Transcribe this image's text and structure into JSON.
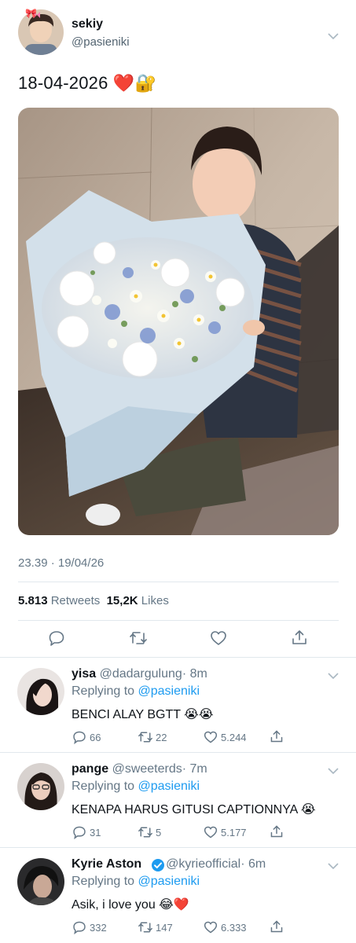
{
  "tweet": {
    "author_name": "sekiy",
    "author_handle": "@pasieniki",
    "author_emoji": "🎀",
    "text": "18-04-2026 ❤️🔐",
    "timestamp": "23.39 · 19/04/26",
    "retweets_count": "5.813",
    "retweets_label": "Retweets",
    "likes_count": "15,2K",
    "likes_label": "Likes"
  },
  "replies": [
    {
      "name": "yisa",
      "handle": "@dadargulung",
      "time": "· 8m",
      "replying_prefix": "Replying to",
      "replying_to": "@pasieniki",
      "text": "BENCI ALAY BGTT 😭😭",
      "reply_count": "66",
      "retweet_count": "22",
      "like_count": "5.244",
      "verified": false
    },
    {
      "name": "pange",
      "handle": "@sweeterds",
      "time": "· 7m",
      "replying_prefix": "Replying to",
      "replying_to": "@pasieniki",
      "text": "KENAPA HARUS GITUSI CAPTIONNYA 😭",
      "reply_count": "31",
      "retweet_count": "5",
      "like_count": "5.177",
      "verified": false
    },
    {
      "name": "Kyrie Aston",
      "handle": "@kyrieofficial",
      "time": "· 6m",
      "replying_prefix": "Replying to",
      "replying_to": "@pasieniki",
      "text": "Asik, i love you 😂❤️",
      "reply_count": "332",
      "retweet_count": "147",
      "like_count": "6.333",
      "verified": true
    }
  ],
  "icons": {
    "reply": "reply-icon",
    "retweet": "retweet-icon",
    "like": "heart-icon",
    "share": "share-icon",
    "caret": "chevron-down-icon",
    "verified": "verified-badge-icon"
  },
  "colors": {
    "link_blue": "#1d9bf0",
    "secondary_text": "#657786",
    "divider": "#e1e8ed",
    "verified": "#1d9bf0",
    "heart_emoji": "#e0245e"
  }
}
